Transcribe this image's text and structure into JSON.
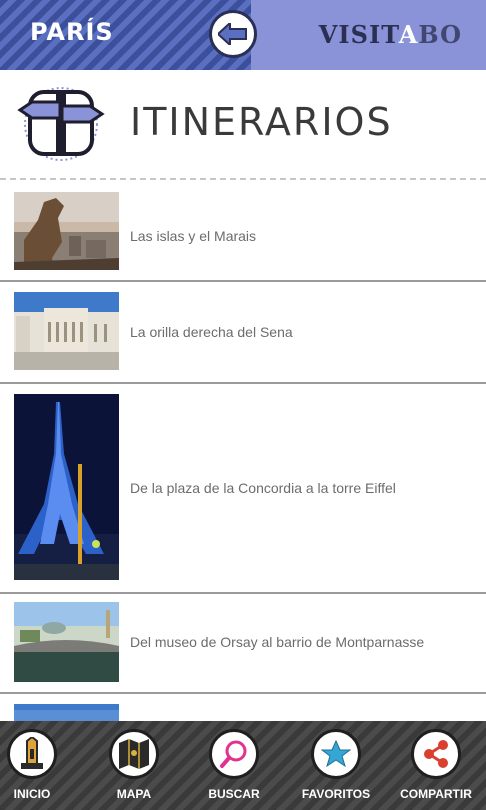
{
  "header": {
    "city": "PARÍS",
    "brand": {
      "part1": "VISIT",
      "part2": "A",
      "part3": "BO"
    }
  },
  "section": {
    "title": "ITINERARIOS"
  },
  "itineraries": [
    {
      "label": "Las islas y el Marais"
    },
    {
      "label": "La orilla derecha del Sena"
    },
    {
      "label": "De la plaza de la Concordia a la torre Eiffel"
    },
    {
      "label": "Del museo de Orsay al barrio de Montparnasse"
    }
  ],
  "tabbar": {
    "items": [
      {
        "label": "INICIO",
        "icon": "home-tower-icon"
      },
      {
        "label": "MAPA",
        "icon": "map-icon"
      },
      {
        "label": "BUSCAR",
        "icon": "search-icon"
      },
      {
        "label": "FAVORITOS",
        "icon": "star-icon"
      },
      {
        "label": "COMPARTIR",
        "icon": "share-icon"
      }
    ]
  },
  "colors": {
    "header": "#3c4f9c",
    "accent": "#8a93d8",
    "tabbar": "#3a3a3a",
    "search_pink": "#e0338f",
    "star_blue": "#35a6d6",
    "share_red": "#d9402f"
  }
}
